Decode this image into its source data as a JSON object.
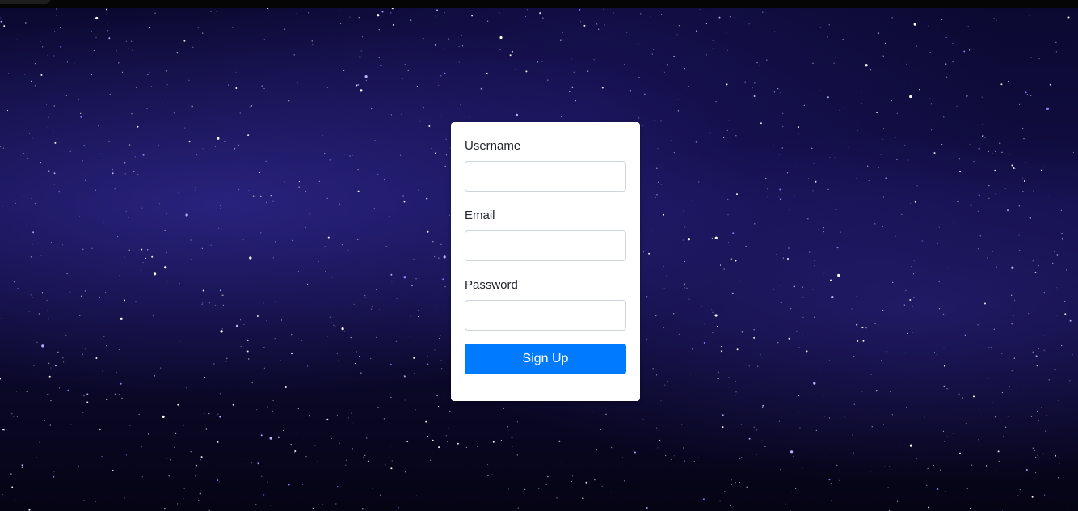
{
  "form": {
    "username_label": "Username",
    "username_value": "",
    "email_label": "Email",
    "email_value": "",
    "password_label": "Password",
    "password_value": "",
    "submit_label": "Sign Up"
  },
  "colors": {
    "accent": "#007bff",
    "card_background": "#ffffff",
    "background": "#0b0930"
  },
  "background_image": "starry-night-sky"
}
